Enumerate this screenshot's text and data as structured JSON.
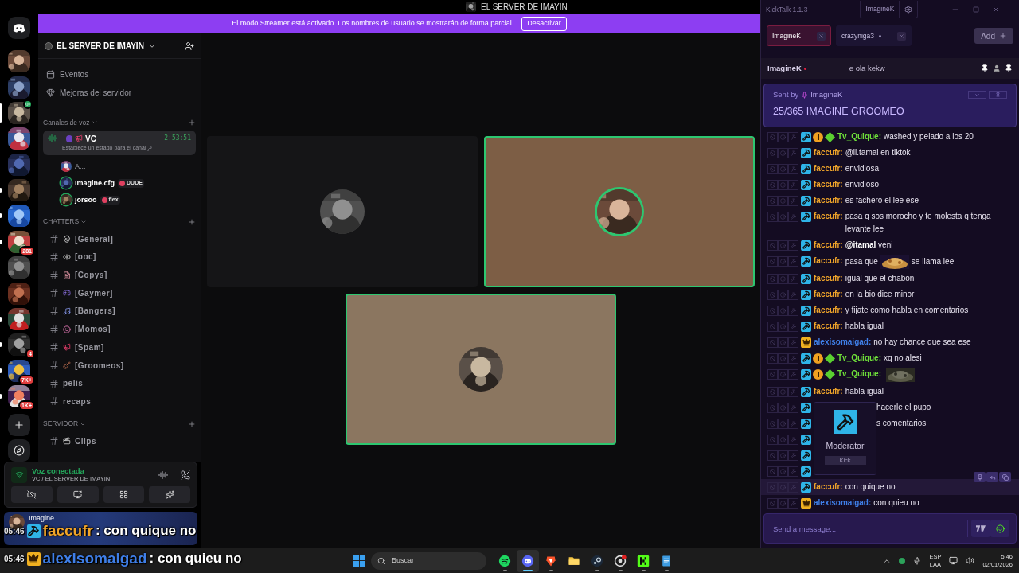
{
  "discord": {
    "title": "EL SERVER DE IMAYIN",
    "banner": {
      "text": "El modo Streamer está activado. Los nombres de usuario se mostrarán de forma parcial.",
      "button": "Desactivar"
    },
    "servers": [
      {
        "selected": false,
        "unread": false,
        "voice": false
      },
      {
        "selected": false,
        "unread": false,
        "voice": false
      },
      {
        "selected": true,
        "unread": false,
        "voice": true
      },
      {
        "selected": false,
        "unread": false,
        "voice": false
      },
      {
        "selected": false,
        "unread": false,
        "voice": false
      },
      {
        "selected": false,
        "unread": true,
        "voice": false
      },
      {
        "selected": false,
        "unread": true,
        "voice": false
      },
      {
        "selected": false,
        "unread": true,
        "voice": false,
        "badge": "281"
      },
      {
        "selected": false,
        "unread": false,
        "voice": false
      },
      {
        "selected": false,
        "unread": false,
        "voice": false
      },
      {
        "selected": false,
        "unread": true,
        "voice": false
      },
      {
        "selected": false,
        "unread": true,
        "voice": false,
        "badge": "4"
      },
      {
        "selected": false,
        "unread": true,
        "voice": false,
        "badge": "7K+"
      },
      {
        "selected": false,
        "unread": true,
        "voice": false,
        "badge": "1K+"
      }
    ],
    "server_name": "EL SERVER DE IMAYIN",
    "menu": [
      "Eventos",
      "Mejoras del servidor"
    ],
    "categories": [
      {
        "name": "Canales de voz",
        "channels": [
          {
            "kind": "voice",
            "name": "VC",
            "selected": true,
            "timer": "2:53:51",
            "status": "Establece un estado para el canal",
            "members": [
              {
                "name": "A...",
                "speaking": false
              },
              {
                "name": "Imagine.cfg",
                "speaking": true,
                "tag": "DUDE"
              },
              {
                "name": "jorsoo",
                "speaking": true,
                "tag": "flex"
              }
            ]
          }
        ]
      },
      {
        "name": "CHATTERS",
        "channels": [
          {
            "kind": "skull",
            "name": "[General]"
          },
          {
            "kind": "eyes",
            "name": "[ooc]"
          },
          {
            "kind": "file",
            "name": "[Copys]"
          },
          {
            "kind": "gamepad",
            "name": "[Gaymer]"
          },
          {
            "kind": "music",
            "name": "[Bangers]"
          },
          {
            "kind": "smile",
            "name": "[Momos]"
          },
          {
            "kind": "megaphone",
            "name": "[Spam]"
          },
          {
            "kind": "guitar",
            "name": "[Groomeos]"
          },
          {
            "kind": "plain",
            "name": "pelis"
          },
          {
            "kind": "plain",
            "name": "recaps"
          }
        ]
      },
      {
        "name": "SERVIDOR",
        "channels": [
          {
            "kind": "clapper",
            "name": "Clips"
          }
        ]
      }
    ],
    "voice_panel": {
      "status": "Voz conectada",
      "location": "VC / EL SERVER DE IMAYIN"
    },
    "user": {
      "name": "Imagine"
    },
    "tiles": [
      {
        "speaking": false
      },
      {
        "speaking": true
      },
      {
        "speaking": true
      }
    ]
  },
  "kicktalk": {
    "app_title": "KickTalk 1.1.3",
    "account": "ImagineK",
    "tabs": [
      {
        "label": "ImagineK",
        "selected": true,
        "live": false
      },
      {
        "label": "crazyniga3",
        "selected": false,
        "live": true
      }
    ],
    "add_button": "Add",
    "channel": {
      "name": "ImagineK",
      "live": true,
      "title": "e ola kekw"
    },
    "pinned": {
      "sent_by": "Sent by",
      "author": "ImagineK",
      "text": "25/365 IMAGINE GROOMEO"
    },
    "messages": [
      {
        "kind": "message",
        "badges": [
          {
            "kind": "moderator"
          },
          {
            "kind": "sub"
          },
          {
            "kind": "gifter"
          }
        ],
        "user": "Tv_Quique:",
        "color": "#6fe03a",
        "text": "washed y pelado a los 20",
        "hovered": false
      },
      {
        "kind": "message",
        "badges": [
          {
            "kind": "moderator"
          }
        ],
        "user": "faccufr:",
        "color": "#f0a52a",
        "text": "@ii.tamal en tiktok",
        "hovered": false
      },
      {
        "kind": "message",
        "badges": [
          {
            "kind": "moderator"
          }
        ],
        "user": "faccufr:",
        "color": "#f0a52a",
        "text": "envidiosa",
        "hovered": false
      },
      {
        "kind": "message",
        "badges": [
          {
            "kind": "moderator"
          }
        ],
        "user": "faccufr:",
        "color": "#f0a52a",
        "text": "envidioso",
        "hovered": false
      },
      {
        "kind": "message",
        "badges": [
          {
            "kind": "moderator"
          }
        ],
        "user": "faccufr:",
        "color": "#f0a52a",
        "text": "es fachero el lee ese",
        "hovered": false
      },
      {
        "kind": "message",
        "badges": [
          {
            "kind": "moderator"
          }
        ],
        "user": "faccufr:",
        "color": "#f0a52a",
        "text": "pasa q sos morocho y te molesta q tenga levante lee",
        "hovered": false
      },
      {
        "kind": "message",
        "badges": [
          {
            "kind": "moderator"
          }
        ],
        "user": "faccufr:",
        "color": "#f0a52a",
        "text": "**@itamal** veni",
        "hovered": false
      },
      {
        "kind": "message",
        "badges": [
          {
            "kind": "moderator"
          }
        ],
        "user": "faccufr:",
        "color": "#f0a52a",
        "parts": [
          {
            "kind": "text",
            "text": "pasa que"
          },
          {
            "kind": "emote"
          },
          {
            "kind": "text",
            "text": "se llama lee"
          }
        ],
        "hovered": false
      },
      {
        "kind": "message",
        "badges": [
          {
            "kind": "moderator"
          }
        ],
        "user": "faccufr:",
        "color": "#f0a52a",
        "text": "igual que el chabon",
        "hovered": false
      },
      {
        "kind": "message",
        "badges": [
          {
            "kind": "moderator"
          }
        ],
        "user": "faccufr:",
        "color": "#f0a52a",
        "text": "en la bio dice minor",
        "hovered": false
      },
      {
        "kind": "message",
        "badges": [
          {
            "kind": "moderator"
          }
        ],
        "user": "faccufr:",
        "color": "#f0a52a",
        "text": "y fijate como habla en comentarios",
        "hovered": false
      },
      {
        "kind": "message",
        "badges": [
          {
            "kind": "moderator"
          }
        ],
        "user": "faccufr:",
        "color": "#f0a52a",
        "text": "habla igual",
        "hovered": false
      },
      {
        "kind": "message",
        "badges": [
          {
            "kind": "crown"
          }
        ],
        "user": "alexisomaigad:",
        "color": "#3f7fe8",
        "text": "no hay chance que sea ese",
        "hovered": false
      },
      {
        "kind": "message",
        "badges": [
          {
            "kind": "moderator"
          },
          {
            "kind": "sub"
          },
          {
            "kind": "gifter"
          }
        ],
        "user": "Tv_Quique:",
        "color": "#6fe03a",
        "text": "xq no alesi",
        "hovered": false
      },
      {
        "kind": "message",
        "badges": [
          {
            "kind": "moderator"
          },
          {
            "kind": "sub"
          },
          {
            "kind": "gifter"
          }
        ],
        "user": "Tv_Quique:",
        "color": "#6fe03a",
        "parts": [
          {
            "kind": "emote"
          }
        ],
        "hovered": false
      },
      {
        "kind": "message",
        "badges": [
          {
            "kind": "moderator"
          }
        ],
        "user": "faccufr:",
        "color": "#f0a52a",
        "text": "habla igual",
        "hovered": false
      },
      {
        "kind": "covered",
        "badges": [
          {
            "kind": "moderator"
          }
        ],
        "text": "hacerle el pupo",
        "hovered": false
      },
      {
        "kind": "covered",
        "badges": [
          {
            "kind": "moderator"
          }
        ],
        "text": "s comentarios",
        "hovered": false
      },
      {
        "kind": "covered",
        "badges": [
          {
            "kind": "moderator"
          }
        ],
        "hovered": false
      },
      {
        "kind": "covered",
        "badges": [
          {
            "kind": "moderator"
          }
        ],
        "hovered": false
      },
      {
        "kind": "covered",
        "badges": [
          {
            "kind": "moderator"
          }
        ],
        "hovered": false
      },
      {
        "kind": "message",
        "badges": [
          {
            "kind": "moderator"
          }
        ],
        "user": "faccufr:",
        "color": "#f0a52a",
        "text": "con quique no",
        "hovered": true
      },
      {
        "kind": "message",
        "badges": [
          {
            "kind": "crown"
          }
        ],
        "user": "alexisomaigad:",
        "color": "#3f7fe8",
        "text": "con quieu no",
        "hovered": false
      }
    ],
    "tooltip": {
      "title": "Moderator",
      "platform": "Kick"
    },
    "input": {
      "placeholder": "Send a message..."
    }
  },
  "stream_overlay": [
    {
      "time": "05:46",
      "kind": "moderator",
      "user": "faccufr",
      "color": "#f0a52a",
      "text": ": con quique no"
    },
    {
      "time": "05:46",
      "kind": "crown",
      "user": "alexisomaigad",
      "color": "#3f7fe8",
      "text": ": con quieu no"
    }
  ],
  "taskbar": {
    "search": "Buscar",
    "apps": [
      {
        "kind": "spotify",
        "running": true,
        "active": false
      },
      {
        "kind": "discord",
        "running": true,
        "active": true
      },
      {
        "kind": "brave",
        "running": true,
        "active": false
      },
      {
        "kind": "folder",
        "running": false,
        "active": false
      },
      {
        "kind": "steam",
        "running": true,
        "active": false
      },
      {
        "kind": "recorder",
        "running": true,
        "active": false
      },
      {
        "kind": "kick",
        "running": true,
        "active": false
      },
      {
        "kind": "notepad",
        "running": true,
        "active": false
      }
    ],
    "language": "ESP",
    "layout": "LAA",
    "time": "5:46",
    "date": "02/01/2026"
  }
}
